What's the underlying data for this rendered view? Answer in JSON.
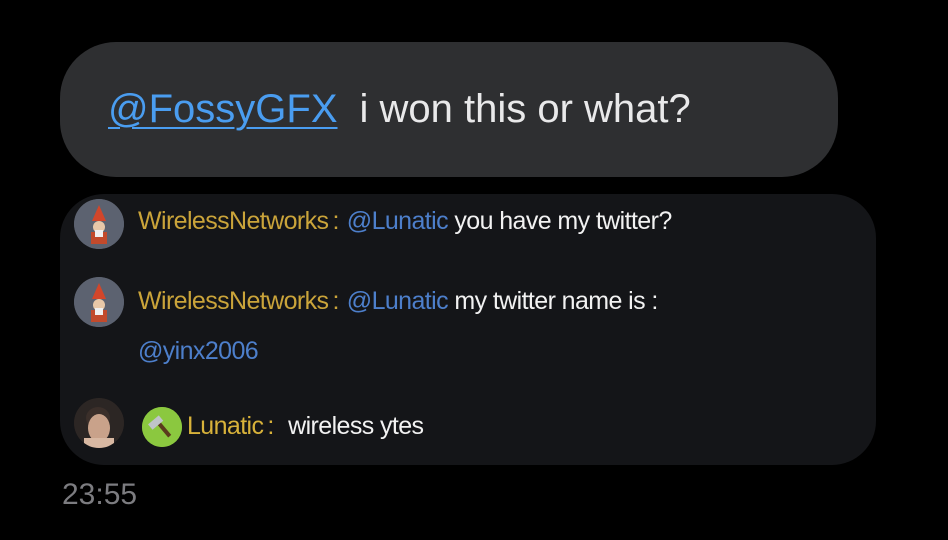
{
  "reply_bubble": {
    "mention": "@FossyGFX",
    "message": "i won this or what?"
  },
  "screenshot": {
    "messages": [
      {
        "author": "WirelessNetworks",
        "separator": ":",
        "mention": "@Lunatic",
        "text": "you have my twitter?"
      },
      {
        "author": "WirelessNetworks",
        "separator": ":",
        "mention": "@Lunatic",
        "text": "my twitter name is :",
        "continuation": "@yinx2006"
      },
      {
        "author": "Lunatic",
        "separator": ":",
        "text": "wireless ytes"
      }
    ]
  },
  "timestamp": "23:55",
  "colors": {
    "background": "#000000",
    "bubble": "#2e2f31",
    "link": "#4a9df0",
    "username": "#caa43a",
    "mention": "#4d7fcb"
  },
  "icons": [
    "gnome-avatar",
    "user-photo-avatar",
    "hammer-badge-icon"
  ]
}
